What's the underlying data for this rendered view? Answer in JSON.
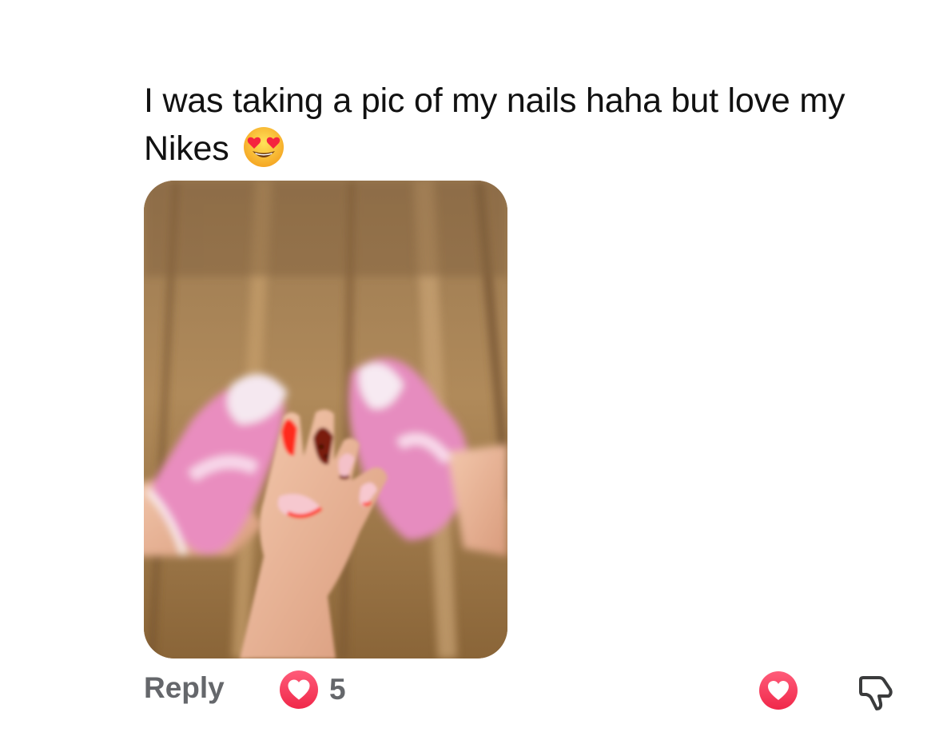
{
  "comment": {
    "text": "I was taking a pic of my nails haha but love my Nikes",
    "emoji": "heart-eyes-emoji"
  },
  "photo": {
    "subject": "hand-with-painted-nails-over-pink-sneakers"
  },
  "actions": {
    "reply_label": "Reply",
    "reaction_count": "5",
    "reaction_icon": "heart-icon",
    "like_icon": "heart-icon",
    "dislike_icon": "thumbs-down-icon"
  },
  "colors": {
    "text": "#111111",
    "muted": "#65676b",
    "heart": "#f0284a"
  }
}
